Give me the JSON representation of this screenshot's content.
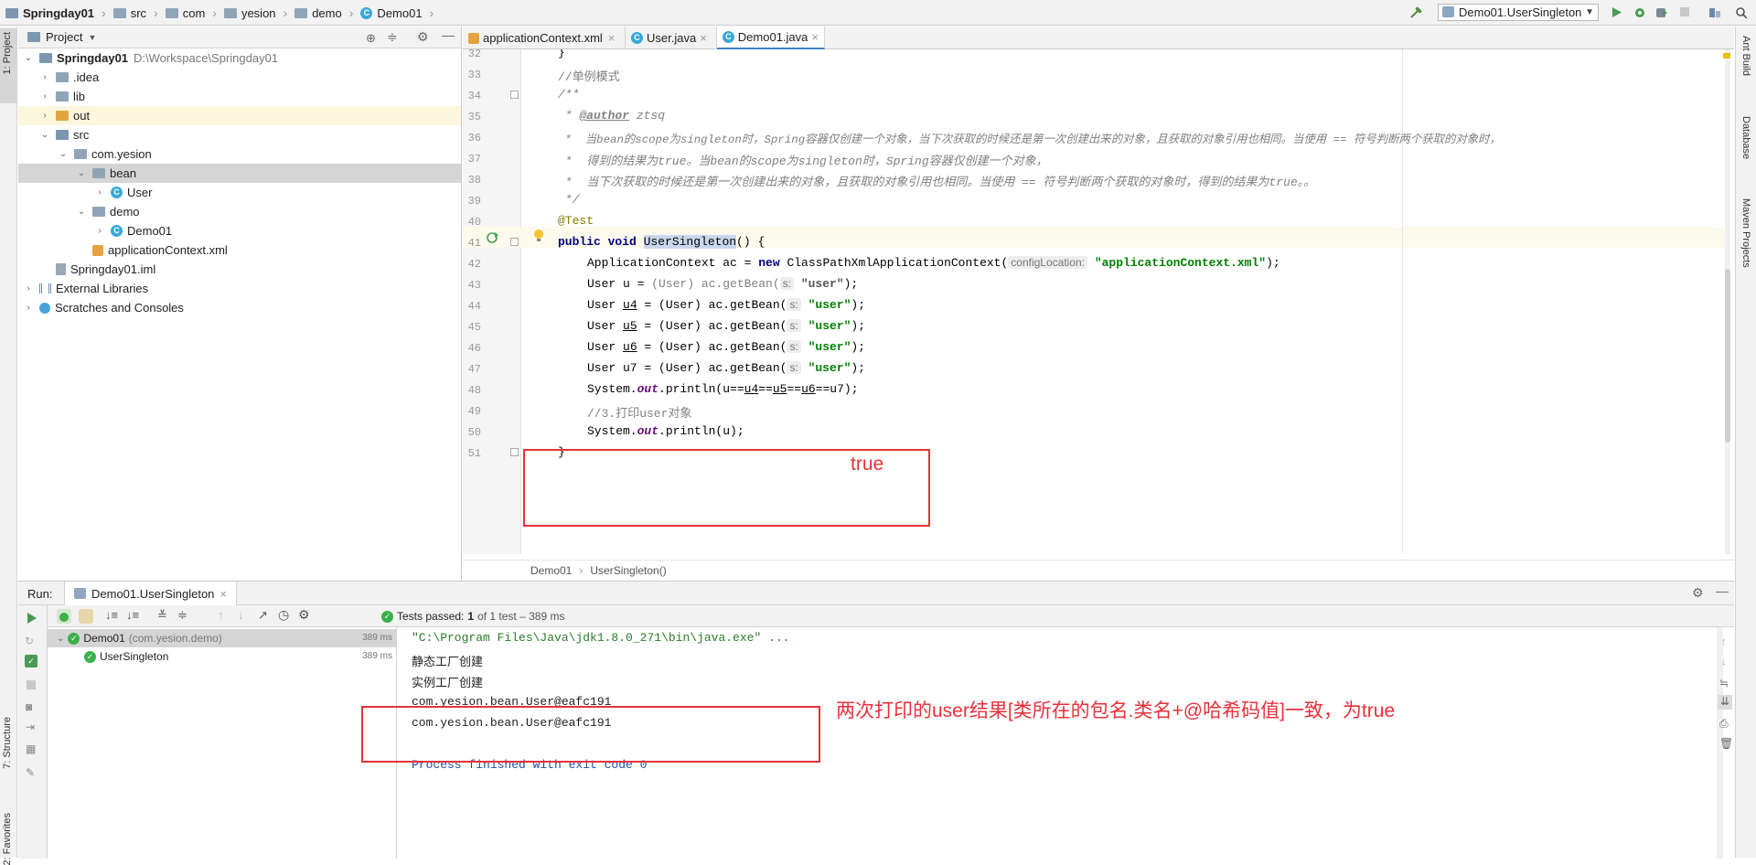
{
  "navbar": {
    "crumbs": [
      "Springday01",
      "src",
      "com",
      "yesion",
      "demo",
      "Demo01"
    ],
    "run_config": "Demo01.UserSingleton"
  },
  "left_stripe": {
    "project_tab": "1: Project",
    "structure_tab": "7: Structure",
    "favorites_tab": "2: Favorites"
  },
  "right_stripe": {
    "ant_tab": "Ant Build",
    "database_tab": "Database",
    "maven_tab": "Maven Projects"
  },
  "project_panel": {
    "title": "Project",
    "items": [
      {
        "label": "Springday01",
        "path": "D:\\Workspace\\Springday01"
      },
      {
        "label": ".idea"
      },
      {
        "label": "lib"
      },
      {
        "label": "out"
      },
      {
        "label": "src"
      },
      {
        "label": "com.yesion"
      },
      {
        "label": "bean"
      },
      {
        "label": "User"
      },
      {
        "label": "demo"
      },
      {
        "label": "Demo01"
      },
      {
        "label": "applicationContext.xml"
      },
      {
        "label": "Springday01.iml"
      },
      {
        "label": "External Libraries"
      },
      {
        "label": "Scratches and Consoles"
      }
    ]
  },
  "editor": {
    "tabs": [
      {
        "label": "applicationContext.xml"
      },
      {
        "label": "User.java"
      },
      {
        "label": "Demo01.java"
      }
    ],
    "breadcrumb": [
      "Demo01",
      "UserSingleton()"
    ],
    "line_numbers": [
      "32",
      "33",
      "34",
      "35",
      "36",
      "37",
      "38",
      "39",
      "40",
      "41",
      "42",
      "43",
      "44",
      "45",
      "46",
      "47",
      "48",
      "49",
      "50",
      "51"
    ],
    "code": {
      "l33": "//单例模式",
      "l34": "/**",
      "l35_tag": "@author",
      "l35_rest": " ztsq",
      "l36": " *  当bean的scope为singleton时，Spring容器仅创建一个对象，当下次获取的时候还是第一次创建出来的对象，且获取的对象引用也相同。当使用 == 符号判断两个获取的对象时，",
      "l37": " *  得到的结果为true。当bean的scope为singleton时，Spring容器仅创建一个对象，",
      "l38": " *  当下次获取的时候还是第一次创建出来的对象，且获取的对象引用也相同。当使用 == 符号判断两个获取的对象时，得到的结果为true。。",
      "l39": " */",
      "l40": "@Test",
      "l41_kw": "public void ",
      "l41_name": "UserSingleton",
      "l41_rest": "() {",
      "l42_a": "ApplicationContext ac = ",
      "l42_new": "new",
      "l42_b": " ClassPathXmlApplicationContext(",
      "l42_hint": "configLocation:",
      "l42_str": " \"applicationContext.xml\"",
      "l42_end": ");",
      "l43_a": "User u = ",
      "l43_cast": "(User) ac.getBean(",
      "l43_hint": "s:",
      "l43_str": " \"user\"",
      "l43_end": ");",
      "l44_a": "User ",
      "l44_var": "u4",
      "l45_var": "u5",
      "l46_var": "u6",
      "l47_a": "User u7",
      "lx_b": " = (User) ac.getBean(",
      "lx_hint": "s:",
      "lx_str": " \"user\"",
      "lx_end": ");",
      "l48_a": "System.",
      "l48_out": "out",
      "l48_b": ".println(u==",
      "l48_u4": "u4",
      "l48_eq": "==",
      "l48_u5": "u5",
      "l48_u6": "u6",
      "l48_c": "==u7);",
      "l49": "//3.打印user对象",
      "l50_a": "System.",
      "l50_out": "out",
      "l50_b": ".println(u);",
      "l51": "}",
      "l32": "}"
    },
    "annotation_true": "true"
  },
  "run_panel": {
    "label": "Run:",
    "tab": "Demo01.UserSingleton",
    "status_prefix": "Tests passed:",
    "status_count": "1",
    "status_suffix": "of 1 test – 389 ms",
    "tree": [
      {
        "label": "Demo01",
        "detail": "(com.yesion.demo)",
        "time": "389 ms"
      },
      {
        "label": "UserSingleton",
        "time": "389 ms"
      }
    ],
    "console": [
      "\"C:\\Program Files\\Java\\jdk1.8.0_271\\bin\\java.exe\" ...",
      "静态工厂创建",
      "实例工厂创建",
      "com.yesion.bean.User@eafc191",
      "com.yesion.bean.User@eafc191",
      "",
      "Process finished with exit code 0"
    ],
    "annotation": "两次打印的user结果[类所在的包名.类名+@哈希码值]一致，为true"
  },
  "colors": {
    "accent": "#4083c9",
    "annotation_red": "#e8313a",
    "string_green": "#008000",
    "keyword_navy": "#000080"
  }
}
